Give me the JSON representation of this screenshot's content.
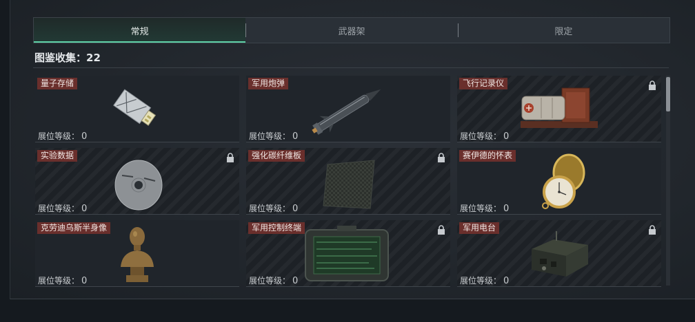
{
  "tabs": [
    {
      "label": "常规",
      "active": true
    },
    {
      "label": "武器架",
      "active": false
    },
    {
      "label": "限定",
      "active": false
    }
  ],
  "collection": {
    "label": "图鉴收集：",
    "count": "22"
  },
  "level_label": "展位等级：",
  "items": [
    {
      "name": "量子存储",
      "level": "0",
      "locked": false,
      "icon": "usb-drive-icon"
    },
    {
      "name": "军用炮弹",
      "level": "0",
      "locked": false,
      "icon": "artillery-shell-icon"
    },
    {
      "name": "飞行记录仪",
      "level": "0",
      "locked": true,
      "icon": "flight-recorder-icon"
    },
    {
      "name": "实验数据",
      "level": "0",
      "locked": true,
      "icon": "disc-icon"
    },
    {
      "name": "强化碳纤维板",
      "level": "0",
      "locked": true,
      "icon": "carbon-plate-icon"
    },
    {
      "name": "赛伊德的怀表",
      "level": "0",
      "locked": false,
      "icon": "pocket-watch-icon"
    },
    {
      "name": "克劳迪乌斯半身像",
      "level": "0",
      "locked": false,
      "icon": "bust-statue-icon"
    },
    {
      "name": "军用控制终端",
      "level": "0",
      "locked": true,
      "icon": "control-terminal-icon"
    },
    {
      "name": "军用电台",
      "level": "0",
      "locked": true,
      "icon": "radio-icon"
    }
  ],
  "colors": {
    "accent": "#5fd3a8",
    "name_tag": "#6a2f2c"
  }
}
